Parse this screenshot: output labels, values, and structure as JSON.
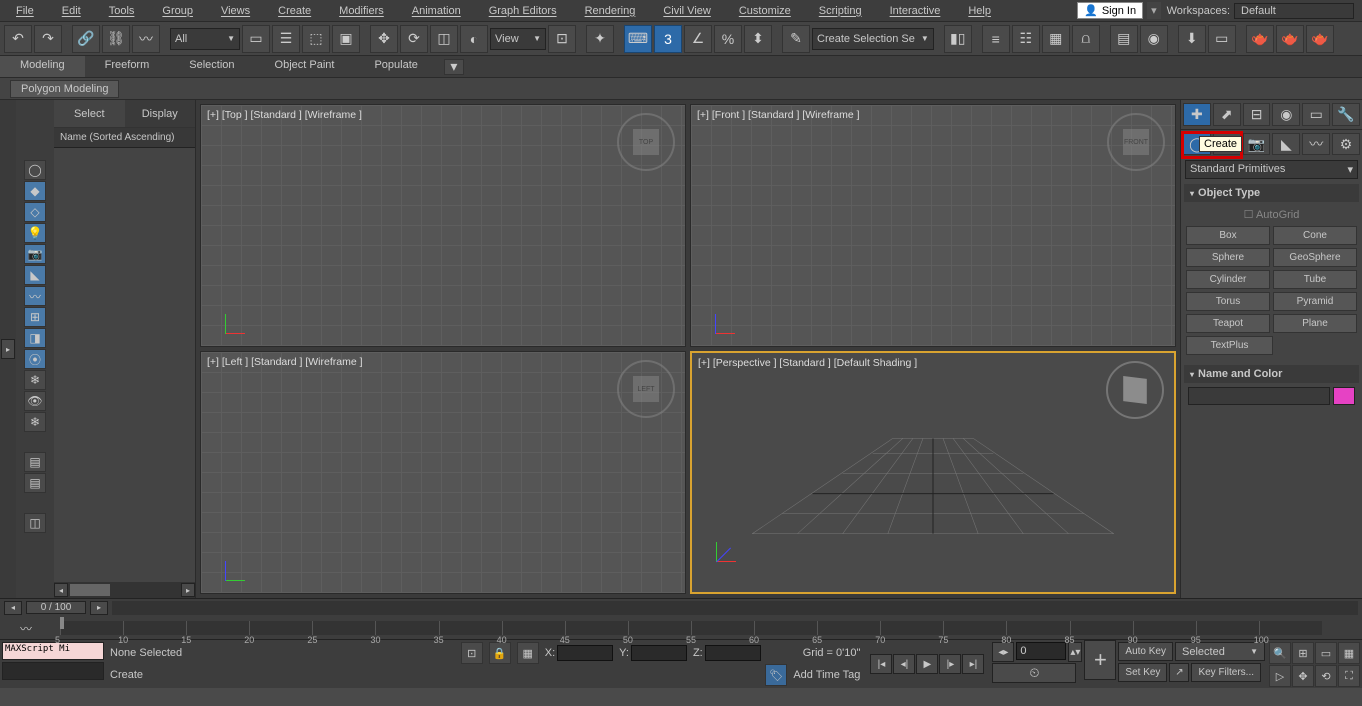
{
  "menu": {
    "file": "File",
    "edit": "Edit",
    "tools": "Tools",
    "group": "Group",
    "views": "Views",
    "create": "Create",
    "modifiers": "Modifiers",
    "animation": "Animation",
    "graph": "Graph Editors",
    "rendering": "Rendering",
    "civil": "Civil View",
    "customize": "Customize",
    "scripting": "Scripting",
    "interactive": "Interactive",
    "help": "Help",
    "signin": "Sign In",
    "workspaces_label": "Workspaces:",
    "workspace": "Default"
  },
  "toolbar": {
    "filter": "All",
    "view": "View",
    "selset": "Create Selection Se"
  },
  "ribbon": {
    "modeling": "Modeling",
    "freeform": "Freeform",
    "selection": "Selection",
    "objpaint": "Object Paint",
    "populate": "Populate",
    "sub": "Polygon Modeling"
  },
  "scene": {
    "tab_select": "Select",
    "tab_display": "Display",
    "name_header": "Name (Sorted Ascending)"
  },
  "viewports": {
    "tl": "[+] [Top ] [Standard ] [Wireframe ]",
    "tr": "[+] [Front ] [Standard ] [Wireframe ]",
    "bl": "[+] [Left ] [Standard ] [Wireframe ]",
    "br": "[+] [Perspective ] [Standard ] [Default Shading ]",
    "cube_top": "TOP",
    "cube_front": "FRONT",
    "cube_left": "LEFT"
  },
  "command": {
    "tooltip": "Create",
    "dropdown": "Standard Primitives",
    "rollout_object": "Object Type",
    "autogrid": "AutoGrid",
    "btns": {
      "box": "Box",
      "cone": "Cone",
      "sphere": "Sphere",
      "geosphere": "GeoSphere",
      "cylinder": "Cylinder",
      "tube": "Tube",
      "torus": "Torus",
      "pyramid": "Pyramid",
      "teapot": "Teapot",
      "plane": "Plane",
      "textplus": "TextPlus"
    },
    "rollout_name": "Name and Color"
  },
  "time": {
    "frame": "0 / 100"
  },
  "timeline": {
    "ticks": [
      "5",
      "10",
      "15",
      "20",
      "25",
      "30",
      "35",
      "40",
      "45",
      "50",
      "55",
      "60",
      "65",
      "70",
      "75",
      "80",
      "85",
      "90",
      "95",
      "100"
    ]
  },
  "status": {
    "maxscript": "MAXScript Mi",
    "create": "Create",
    "none": "None Selected",
    "x": "X:",
    "y": "Y:",
    "z": "Z:",
    "grid": "Grid = 0'10\"",
    "addtag": "Add Time Tag",
    "autokey": "Auto Key",
    "setkey": "Set Key",
    "selected": "Selected",
    "keyfilters": "Key Filters...",
    "spin": "0"
  }
}
